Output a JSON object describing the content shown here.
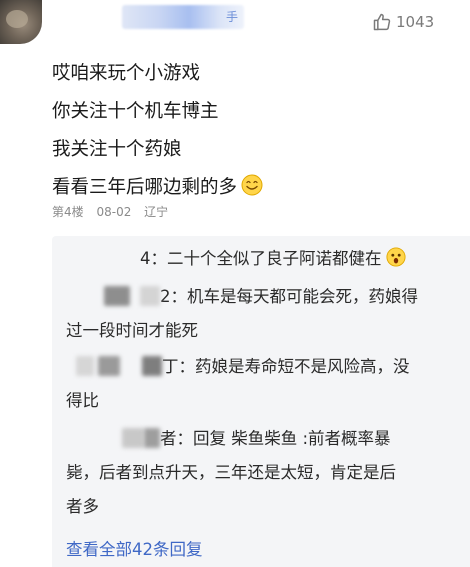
{
  "author": {
    "name_suffix": "手",
    "avatar_alt": "avatar"
  },
  "like": {
    "count": "1043",
    "icon": "thumbs-up-icon"
  },
  "comment": {
    "lines": [
      "哎咱来玩个小游戏",
      "你关注十个机车博主",
      "我关注十个药娘",
      "看看三年后哪边剩的多"
    ],
    "emoji": "smile-emoji"
  },
  "meta": {
    "floor": "第4楼",
    "date": "08-02",
    "location": "辽宁"
  },
  "replies": [
    {
      "name_tail": "4",
      "text_line1": "：二十个全似了良子阿诺都健在",
      "emoji": "shocked-emoji"
    },
    {
      "name_tail": "2",
      "text_line1": "：机车是每天都可能会死，药娘得",
      "text_line2": "过一段时间才能死"
    },
    {
      "name_tail": "丁",
      "text_line1": "：药娘是寿命短不是风险高，没",
      "text_line2": "得比"
    },
    {
      "name_tail": "者",
      "text_line1": "：回复 柴鱼柴鱼 :前者概率暴",
      "text_line2": "毙，后者到点升天，三年还是太短，肯定是后",
      "text_line3": "者多"
    }
  ],
  "view_all": "查看全部42条回复",
  "colors": {
    "link": "#3f68c6",
    "meta": "#8a8a8a",
    "reply_bg": "#f4f5f7"
  }
}
